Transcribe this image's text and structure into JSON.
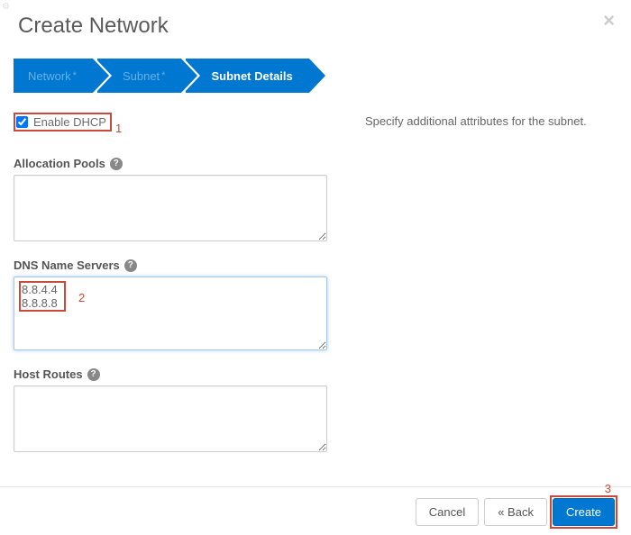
{
  "header": {
    "title": "Create Network"
  },
  "stepper": {
    "steps": [
      {
        "label": "Network",
        "required": "*"
      },
      {
        "label": "Subnet",
        "required": "*"
      },
      {
        "label": "Subnet Details",
        "required": ""
      }
    ]
  },
  "form": {
    "enable_dhcp_label": "Enable DHCP",
    "enable_dhcp_annotation": "1",
    "allocation_pools_label": "Allocation Pools",
    "allocation_pools_value": "",
    "dns_label": "DNS Name Servers",
    "dns_value": "8.8.4.4\n8.8.8.8",
    "dns_annotation": "2",
    "host_routes_label": "Host Routes",
    "host_routes_value": ""
  },
  "help_text": "Specify additional attributes for the subnet.",
  "footer": {
    "cancel": "Cancel",
    "back": "« Back",
    "create": "Create",
    "create_annotation": "3"
  }
}
